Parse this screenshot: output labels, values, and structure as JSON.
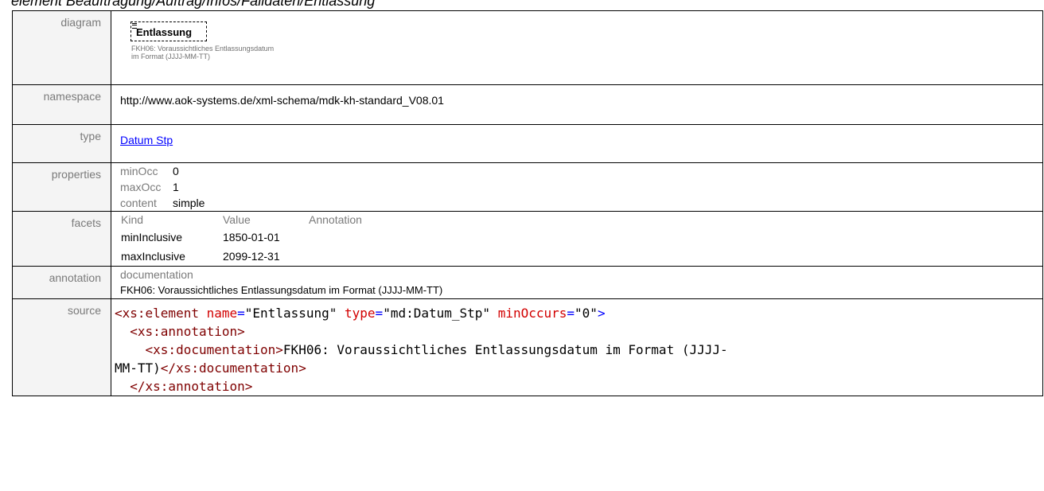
{
  "heading": "element Beauftragung/Auftrag/Infos/Falldaten/Entlassung",
  "labels": {
    "diagram": "diagram",
    "namespace": "namespace",
    "type": "type",
    "properties": "properties",
    "facets": "facets",
    "annotation": "annotation",
    "source": "source"
  },
  "diagram": {
    "element_name": "Entlassung",
    "note": "FKH06: Voraussichtliches Entlassungsdatum im Format (JJJJ-MM-TT)"
  },
  "namespace": "http://www.aok-systems.de/xml-schema/mdk-kh-standard_V08.01",
  "type": {
    "link_text": "Datum Stp"
  },
  "properties": [
    {
      "key": "minOcc",
      "value": "0"
    },
    {
      "key": "maxOcc",
      "value": "1"
    },
    {
      "key": "content",
      "value": "simple"
    }
  ],
  "facets": {
    "headers": [
      "Kind",
      "Value",
      "Annotation"
    ],
    "rows": [
      {
        "kind": "minInclusive",
        "value": "1850-01-01",
        "annotation": ""
      },
      {
        "kind": "maxInclusive",
        "value": "2099-12-31",
        "annotation": ""
      }
    ]
  },
  "annotation": {
    "title": "documentation",
    "text": "FKH06: Voraussichtliches Entlassungsdatum im Format (JJJJ-MM-TT)"
  },
  "source": {
    "l1_open": "<xs:element",
    "l1_attr1": "name",
    "l1_val1": "\"Entlassung\"",
    "l1_attr2": "type",
    "l1_val2": "\"md:Datum_Stp\"",
    "l1_attr3": "minOccurs",
    "l1_val3": "\"0\"",
    "l1_close": ">",
    "l2": "<xs:annotation>",
    "l3_open": "<xs:documentation>",
    "l3_text": "FKH06: Voraussichtliches Entlassungsdatum im Format (JJJJ-",
    "l4_text": "MM-TT)",
    "l4_close": "</xs:documentation>",
    "l5": "</xs:annotation>"
  },
  "colors": {
    "tag": "#7f0000",
    "attribute": "#d20000",
    "punctuation": "#0000ff",
    "label_gray": "#7a7a7a",
    "link": "#0000ff"
  }
}
